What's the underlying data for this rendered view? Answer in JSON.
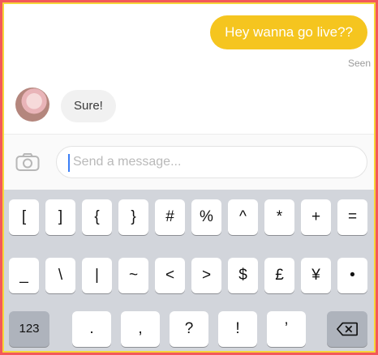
{
  "chat": {
    "outgoing_message": "Hey wanna go live??",
    "seen_label": "Seen",
    "incoming_message": "Sure!"
  },
  "composer": {
    "placeholder": "Send a message...",
    "camera_icon": "camera-icon"
  },
  "keyboard": {
    "row1": [
      "[",
      "]",
      "{",
      "}",
      "#",
      "%",
      "^",
      "*",
      "+",
      "="
    ],
    "row2": [
      "_",
      "\\",
      "|",
      "~",
      "<",
      ">",
      "$",
      "£",
      "¥",
      "•"
    ],
    "row3": [
      ".",
      ",",
      "?",
      "!",
      "’"
    ],
    "mode_key": "123",
    "delete_icon": "backspace-icon"
  },
  "colors": {
    "outgoing_bubble": "#f5c51f",
    "frame_yellow": "#f5d63b",
    "frame_red": "#f3585a",
    "caret": "#3b7ff6"
  }
}
